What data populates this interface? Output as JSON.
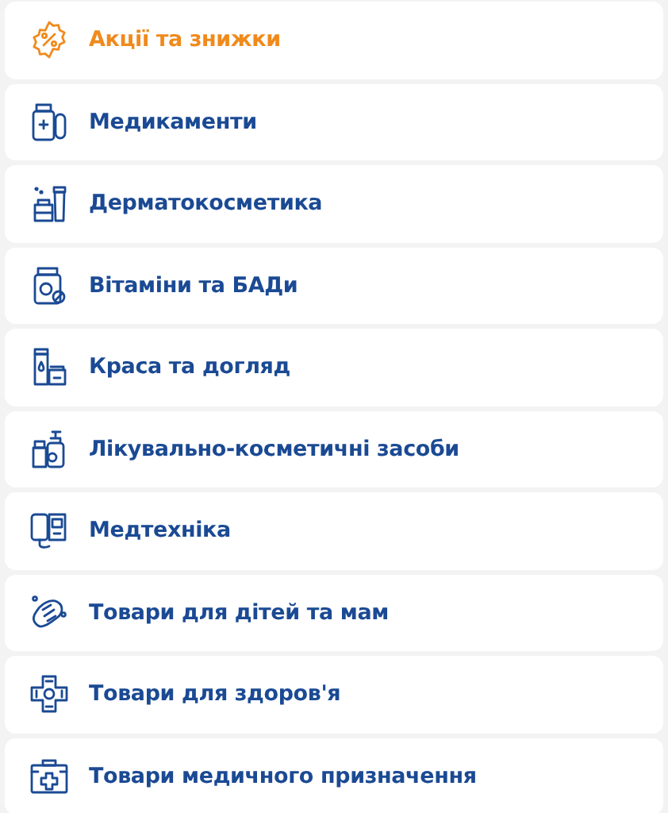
{
  "categories": [
    {
      "label": "Акції та знижки",
      "kind": "promo"
    },
    {
      "label": "Медикаменти",
      "kind": "category"
    },
    {
      "label": "Дерматокосметика",
      "kind": "category"
    },
    {
      "label": "Вітаміни та БАДи",
      "kind": "category"
    },
    {
      "label": "Краса та догляд",
      "kind": "category"
    },
    {
      "label": "Лікувально-косметичні засоби",
      "kind": "category"
    },
    {
      "label": "Медтехніка",
      "kind": "category"
    },
    {
      "label": "Товари для дітей та мам",
      "kind": "category"
    },
    {
      "label": "Товари для здоров'я",
      "kind": "category"
    },
    {
      "label": "Товари медичного призначення",
      "kind": "category"
    }
  ]
}
